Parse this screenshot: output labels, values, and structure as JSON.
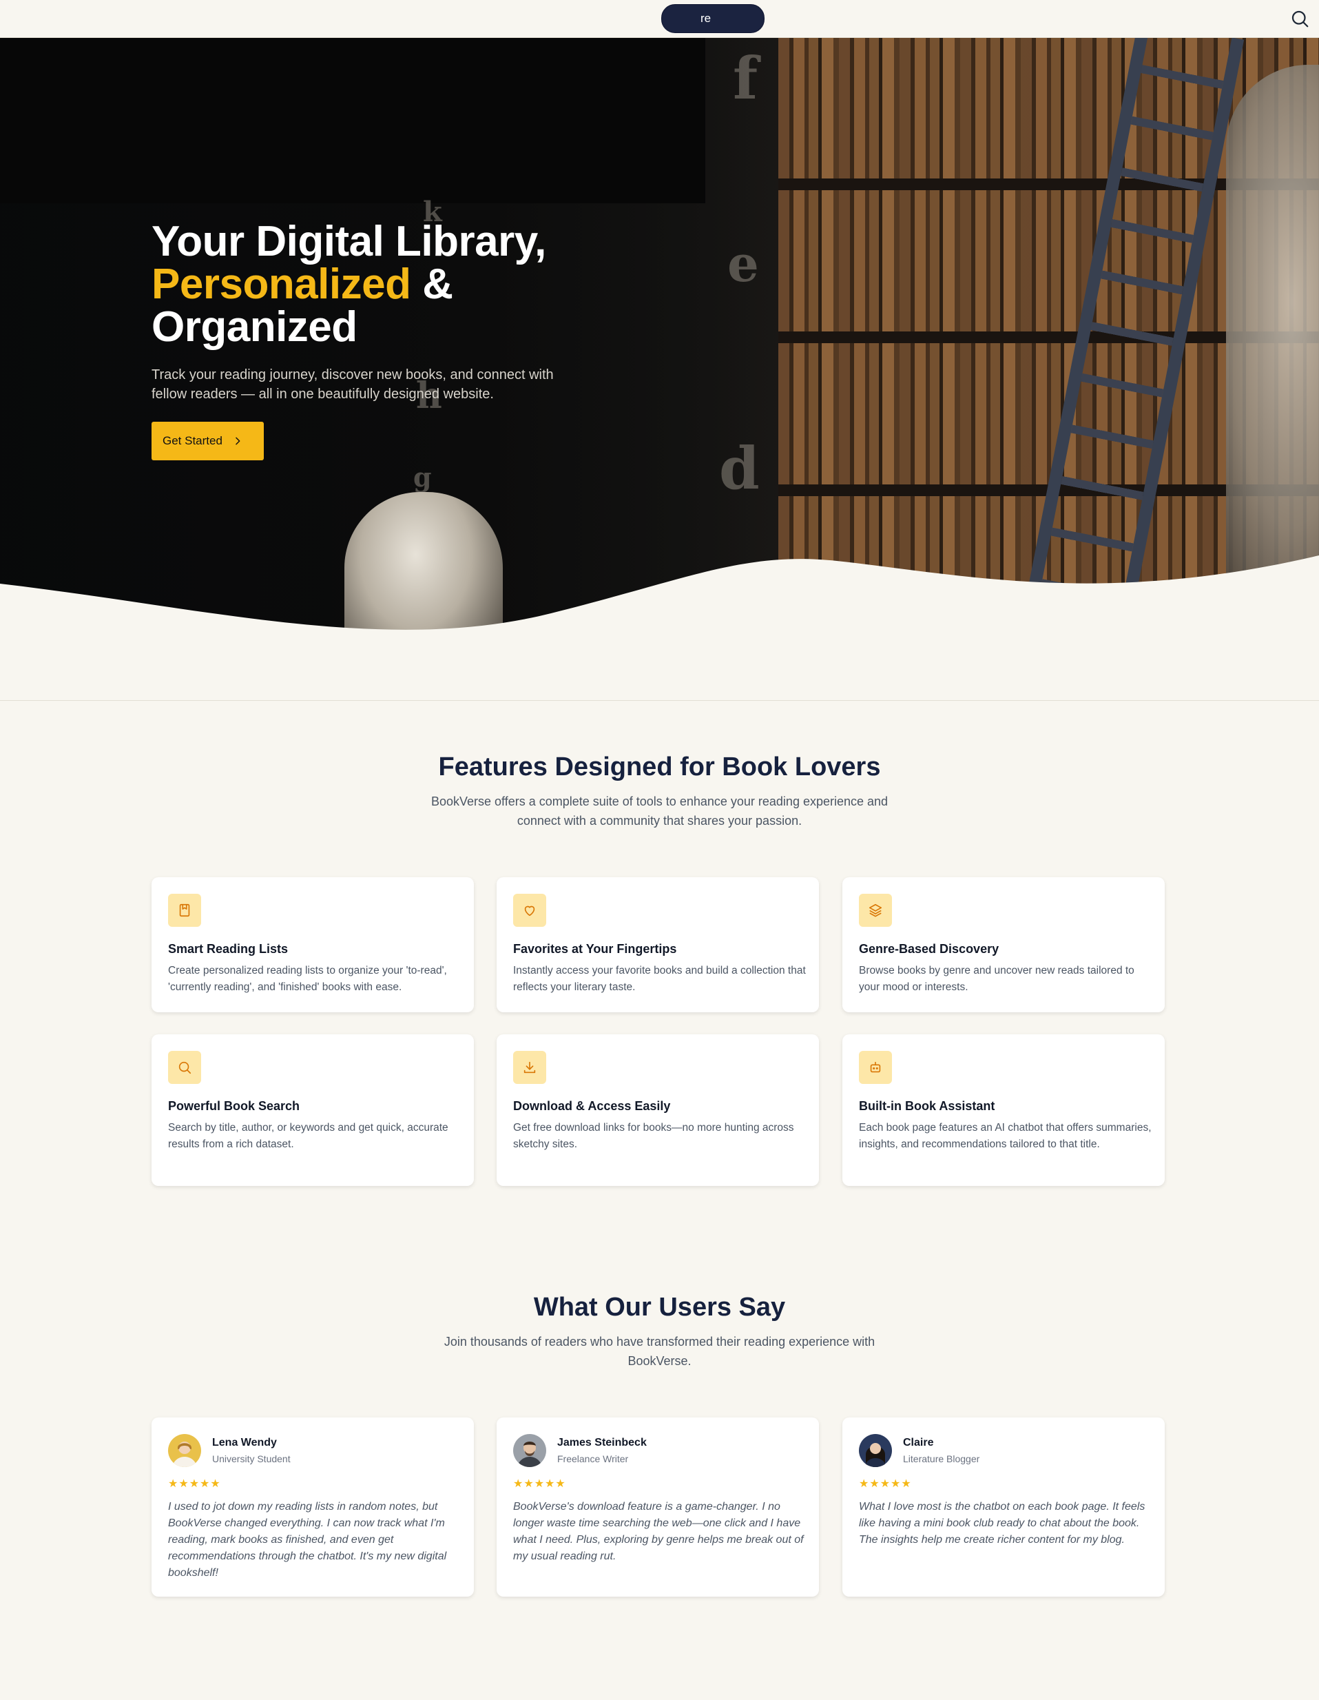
{
  "nav": {
    "pill_label": "re"
  },
  "hero": {
    "title_line1": "Your Digital Library,",
    "title_accent": "Personalized",
    "title_amp": " &",
    "title_line3": "Organized",
    "subtitle": "Track your reading journey, discover new books, and connect with fellow readers — all in one beautifully designed website.",
    "cta_label": "Get Started",
    "decor_letters": [
      "f",
      "k",
      "e",
      "h",
      "d",
      "g"
    ]
  },
  "features": {
    "title": "Features Designed for Book Lovers",
    "subtitle": "BookVerse offers a complete suite of tools to enhance your reading experience and connect with a community that shares your passion.",
    "items": [
      {
        "icon": "bookmark-book-icon",
        "title": "Smart Reading Lists",
        "desc": "Create personalized reading lists to organize your 'to-read', 'currently reading', and 'finished' books with ease."
      },
      {
        "icon": "heart-icon",
        "title": "Favorites at Your Fingertips",
        "desc": "Instantly access your favorite books and build a collection that reflects your literary taste."
      },
      {
        "icon": "layers-icon",
        "title": "Genre-Based Discovery",
        "desc": "Browse books by genre and uncover new reads tailored to your mood or interests."
      },
      {
        "icon": "search-icon",
        "title": "Powerful Book Search",
        "desc": "Search by title, author, or keywords and get quick, accurate results from a rich dataset."
      },
      {
        "icon": "download-icon",
        "title": "Download & Access Easily",
        "desc": "Get free download links for books—no more hunting across sketchy sites."
      },
      {
        "icon": "bot-icon",
        "title": "Built-in Book Assistant",
        "desc": "Each book page features an AI chatbot that offers summaries, insights, and recommendations tailored to that title."
      }
    ]
  },
  "testimonials": {
    "title": "What Our Users Say",
    "subtitle": "Join thousands of readers who have transformed their reading experience with BookVerse.",
    "items": [
      {
        "name": "Lena Wendy",
        "role": "University Student",
        "rating": 5,
        "stars": "★★★★★",
        "quote": "I used to jot down my reading lists in random notes, but BookVerse changed everything. I can now track what I'm reading, mark books as finished, and even get recommendations through the chatbot. It's my new digital bookshelf!"
      },
      {
        "name": "James Steinbeck",
        "role": "Freelance Writer",
        "rating": 5,
        "stars": "★★★★★",
        "quote": "BookVerse's download feature is a game-changer. I no longer waste time searching the web—one click and I have what I need. Plus, exploring by genre helps me break out of my usual reading rut."
      },
      {
        "name": "Claire",
        "role": "Literature Blogger",
        "rating": 5,
        "stars": "★★★★★",
        "quote": "What I love most is the chatbot on each book page. It feels like having a mini book club ready to chat about the book. The insights help me create richer content for my blog."
      }
    ]
  },
  "colors": {
    "accent": "#f5b817",
    "navy": "#16213e",
    "background": "#f8f6f0"
  }
}
